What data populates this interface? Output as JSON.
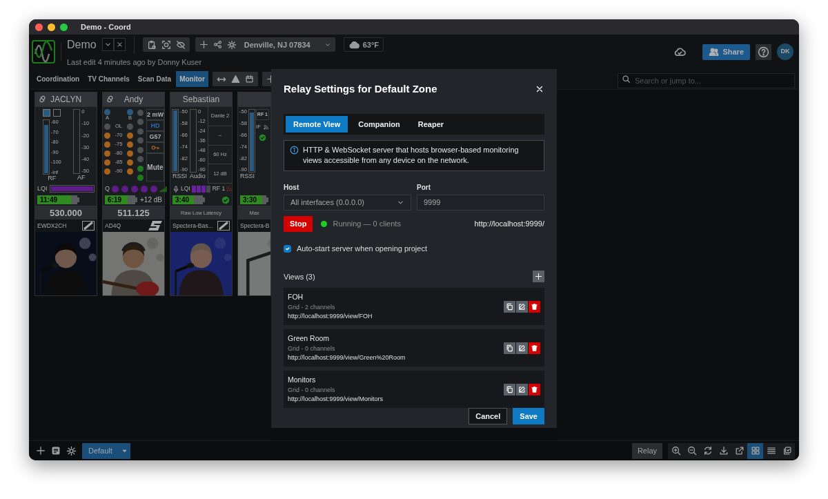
{
  "window": {
    "title": "Demo - Coord"
  },
  "header": {
    "project": "Demo",
    "last_edit": "Last edit 4 minutes ago by Donny Kuser",
    "location": "Denville, NJ 07834",
    "weather": "63°F",
    "share": "Share",
    "avatar": "DK"
  },
  "view_tabs": [
    {
      "label": "Coordination",
      "selected": false
    },
    {
      "label": "TV Channels",
      "selected": false
    },
    {
      "label": "Scan Data",
      "selected": false
    },
    {
      "label": "Monitor",
      "selected": true
    }
  ],
  "search": {
    "placeholder": "Search or jump to..."
  },
  "channels": [
    {
      "kind": "ewdx",
      "name": "JACLYN",
      "linked": true,
      "antennas": [
        {
          "on": true
        },
        {
          "on": false
        }
      ],
      "rf": {
        "label": "RF",
        "level": 0.92,
        "scale": [
          "-60",
          "-70",
          "-80",
          "-90",
          "-100",
          "-inf"
        ]
      },
      "af": {
        "label": "AF",
        "level": 0,
        "scale": [
          "0",
          "-10",
          "-20",
          "-30",
          "-40",
          "-50"
        ]
      },
      "lqi": {
        "label": "LQI",
        "level": 1
      },
      "battery": {
        "reading": "11:49",
        "level": 0.85
      },
      "frequency": "530.000",
      "model": "EWDX2CH"
    },
    {
      "kind": "ad4q",
      "name": "Andy",
      "linked": true,
      "diversity": [
        {
          "label": "A",
          "on": true
        },
        {
          "label": "B",
          "on": true
        }
      ],
      "audio_rows": [
        {
          "label": "OL",
          "color": "#4e5154"
        },
        {
          "label": "-70",
          "color": "#a8621a"
        },
        {
          "label": "-75",
          "color": "#a8621a"
        },
        {
          "label": "-80",
          "color": "#a8621a"
        },
        {
          "label": "-85",
          "color": "#a8621a"
        },
        {
          "label": "-90",
          "color": "#a8621a"
        }
      ],
      "rf_leds": [
        {
          "on": false
        },
        {
          "on": false
        },
        {
          "on": false
        },
        {
          "on": false
        },
        {
          "on": false
        },
        {
          "on": false
        },
        {
          "on": true
        },
        {
          "on": true
        }
      ],
      "tags": [
        {
          "text": "2 mW",
          "color": "#b0b0b0"
        },
        {
          "text": "HD",
          "color": "#2f6aa8"
        },
        {
          "text": "G57",
          "color": "#b0b0b0"
        }
      ],
      "key": true,
      "mute": "Mute",
      "quality": {
        "label": "Q",
        "stars": 5
      },
      "battery": {
        "reading": "6:19",
        "level": 0.75
      },
      "gain": "+12 dB",
      "frequency": "511.125",
      "model": "AD4Q"
    },
    {
      "kind": "spectera",
      "name": "Sebastian",
      "rssi": {
        "label": "RSSI",
        "level": 1,
        "scale": [
          "-50",
          "-58",
          "-66",
          "-74",
          "-82",
          "-90"
        ]
      },
      "audio": {
        "label": "Audio",
        "level": 0,
        "scale": [
          "0",
          "-12",
          "-24",
          "-36",
          "-48",
          "-60",
          "-90"
        ]
      },
      "info": [
        "Dante 2",
        "–",
        "60 Hz",
        "12 dB"
      ],
      "lqi": {
        "label": "LQI",
        "stars": 3
      },
      "rf": "RF 1",
      "rf_alert": true,
      "battery": {
        "reading": "3:40",
        "level": 0.7
      },
      "ok": true,
      "mode": "Raw Low Latency",
      "model": "Spectera-Bas..."
    },
    {
      "kind": "spectera_cut",
      "rssi": {
        "label": "RSSI",
        "level": 0.97,
        "scale": [
          "-50",
          "-58",
          "-66",
          "-74",
          "-82",
          "-90"
        ]
      },
      "rf": "RF 1",
      "if": "IF",
      "ok": true,
      "battery": {
        "reading": "3:30",
        "level": 0.85
      },
      "mode": "Max",
      "model": "Spectera-B"
    }
  ],
  "dialog": {
    "title": "Relay Settings for Default Zone",
    "tabs": [
      {
        "label": "Remote View",
        "selected": true
      },
      {
        "label": "Companion",
        "selected": false
      },
      {
        "label": "Reaper",
        "selected": false
      }
    ],
    "info": "HTTP & WebSocket server that hosts browser-based monitoring views accessible from any device on the network.",
    "host": {
      "label": "Host",
      "value": "All interfaces (0.0.0.0)",
      "disabled": true
    },
    "port": {
      "label": "Port",
      "value": "9999",
      "disabled": true
    },
    "stop": "Stop",
    "status": {
      "running": true,
      "text": "Running — 0 clients"
    },
    "url": "http://localhost:9999/",
    "autostart": {
      "label": "Auto-start server when opening project",
      "checked": true
    },
    "views_title": "Views (3)",
    "views": [
      {
        "name": "FOH",
        "detail": "Grid - 2 channels",
        "url": "http://localhost:9999/view/FOH"
      },
      {
        "name": "Green Room",
        "detail": "Grid - 0 channels",
        "url": "http://localhost:9999/view/Green%20Room"
      },
      {
        "name": "Monitors",
        "detail": "Grid - 0 channels",
        "url": "http://localhost:9999/view/Monitors"
      }
    ],
    "cancel": "Cancel",
    "save": "Save"
  },
  "bottom_bar": {
    "zone": "Default",
    "relay": "Relay",
    "view_modes": [
      {
        "kind": "grid",
        "selected": true
      },
      {
        "kind": "list",
        "selected": false
      }
    ]
  }
}
